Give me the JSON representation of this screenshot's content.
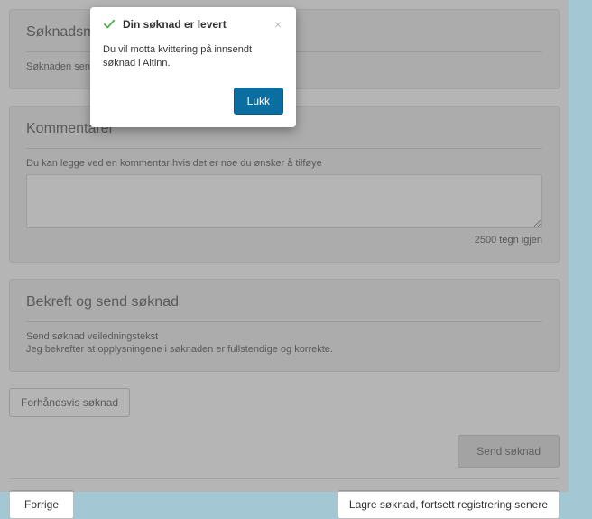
{
  "modal": {
    "title": "Din søknad er levert",
    "body": "Du vil motta kvittering på innsendt søknad i Altinn.",
    "close_label": "Lukk"
  },
  "panels": {
    "sending": {
      "title": "Søknadsm",
      "desc": "Søknaden send"
    },
    "comments": {
      "title": "Kommentarer",
      "desc": "Du kan legge ved en kommentar hvis det er noe du ønsker å tilføye",
      "char_count": "2500 tegn igjen"
    },
    "confirm": {
      "title": "Bekreft og send søknad",
      "line1": "Send søknad veiledningstekst",
      "line2": "Jeg bekrefter at opplysningene i søknaden er fullstendige og korrekte."
    }
  },
  "buttons": {
    "preview": "Forhåndsvis søknad",
    "send": "Send søknad",
    "prev": "Forrige",
    "save": "Lagre søknad, fortsett registrering senere"
  }
}
